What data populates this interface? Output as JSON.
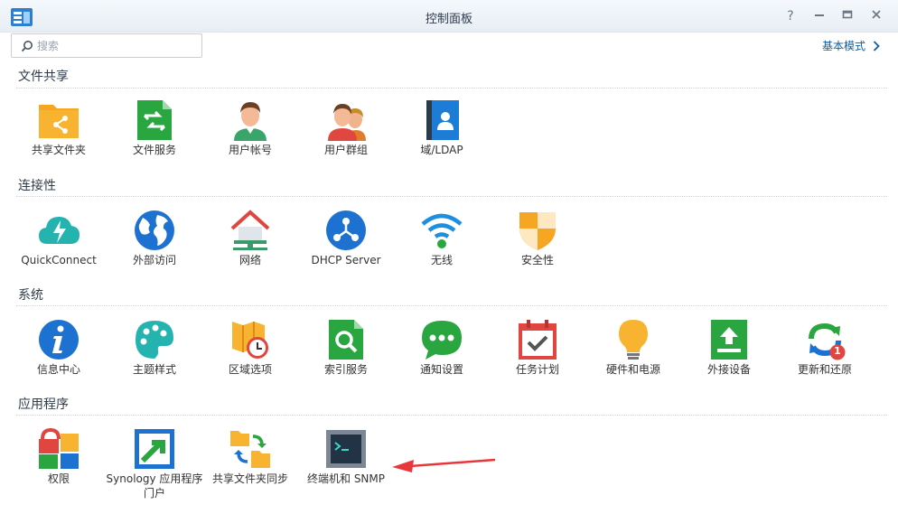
{
  "window": {
    "title": "控制面板"
  },
  "search": {
    "placeholder": "搜索"
  },
  "mode_link": {
    "label": "基本模式"
  },
  "sections": {
    "file_sharing": {
      "title": "文件共享",
      "items": [
        {
          "label": "共享文件夹",
          "icon": "shared-folder-icon"
        },
        {
          "label": "文件服务",
          "icon": "file-services-icon"
        },
        {
          "label": "用户帐号",
          "icon": "user-icon"
        },
        {
          "label": "用户群组",
          "icon": "group-icon"
        },
        {
          "label": "域/LDAP",
          "icon": "domain-ldap-icon"
        }
      ]
    },
    "connectivity": {
      "title": "连接性",
      "items": [
        {
          "label": "QuickConnect",
          "icon": "quickconnect-icon"
        },
        {
          "label": "外部访问",
          "icon": "globe-icon"
        },
        {
          "label": "网络",
          "icon": "network-icon"
        },
        {
          "label": "DHCP Server",
          "icon": "dhcp-icon"
        },
        {
          "label": "无线",
          "icon": "wifi-icon"
        },
        {
          "label": "安全性",
          "icon": "shield-icon"
        }
      ]
    },
    "system": {
      "title": "系统",
      "items": [
        {
          "label": "信息中心",
          "icon": "info-icon"
        },
        {
          "label": "主题样式",
          "icon": "palette-icon"
        },
        {
          "label": "区域选项",
          "icon": "map-clock-icon"
        },
        {
          "label": "索引服务",
          "icon": "search-index-icon"
        },
        {
          "label": "通知设置",
          "icon": "chat-icon"
        },
        {
          "label": "任务计划",
          "icon": "calendar-check-icon"
        },
        {
          "label": "硬件和电源",
          "icon": "lightbulb-icon"
        },
        {
          "label": "外接设备",
          "icon": "upload-device-icon"
        },
        {
          "label": "更新和还原",
          "icon": "refresh-icon",
          "badge": "1"
        }
      ]
    },
    "applications": {
      "title": "应用程序",
      "items": [
        {
          "label": "权限",
          "icon": "privileges-icon"
        },
        {
          "label": "Synology 应用程序门户",
          "icon": "app-portal-icon"
        },
        {
          "label": "共享文件夹同步",
          "icon": "folder-sync-icon"
        },
        {
          "label": "终端机和 SNMP",
          "icon": "terminal-icon"
        }
      ]
    }
  }
}
